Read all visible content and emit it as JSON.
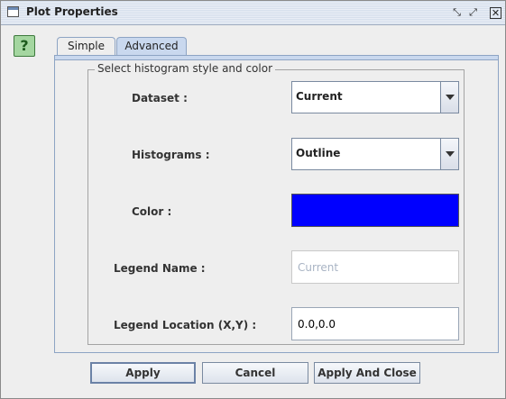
{
  "window": {
    "title": "Plot Properties",
    "controls": [
      "minimize-icon",
      "maximize-icon",
      "close-icon"
    ],
    "control_glyphs": [
      "⤡",
      "⤢",
      "✕"
    ]
  },
  "help": {
    "glyph": "?"
  },
  "tabs": [
    {
      "label": "Simple",
      "active": false
    },
    {
      "label": "Advanced",
      "active": true
    }
  ],
  "group": {
    "title": "Select histogram style and color",
    "dataset": {
      "label": "Dataset :",
      "value": "Current"
    },
    "histograms": {
      "label": "Histograms :",
      "value": "Outline"
    },
    "color": {
      "label": "Color :",
      "value": "#0000ff"
    },
    "legend_name": {
      "label": "Legend Name :",
      "value": "",
      "placeholder": "Current"
    },
    "legend_location": {
      "label": "Legend Location (X,Y) :",
      "value": "0.0,0.0"
    }
  },
  "buttons": {
    "apply": "Apply",
    "cancel": "Cancel",
    "apply_close": "Apply And Close"
  }
}
